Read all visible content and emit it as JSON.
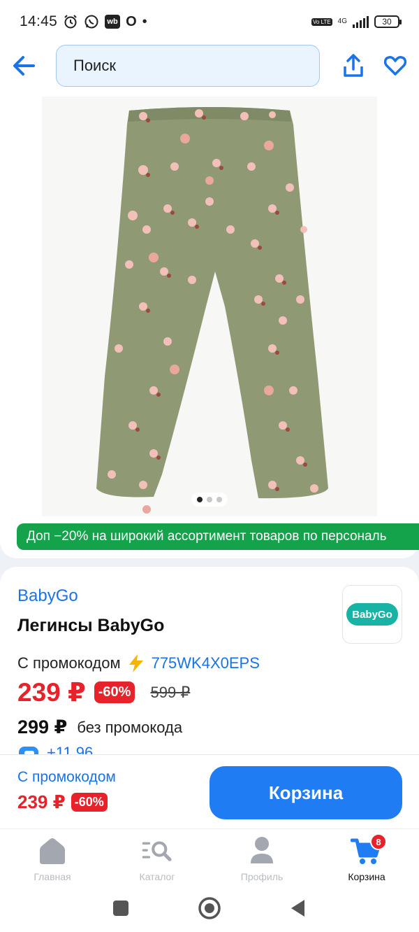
{
  "status_bar": {
    "time": "14:45",
    "icons": [
      "alarm-icon",
      "whatsapp-icon",
      "wb-icon",
      "opera-icon",
      "dot-icon"
    ],
    "wb_label": "wb",
    "opera_label": "O",
    "volte_label": "Vo LTE",
    "network": "4G",
    "battery": "30"
  },
  "header": {
    "search_placeholder": "Поиск",
    "back_icon": "arrow-left-icon",
    "share_icon": "share-icon",
    "favorite_icon": "heart-icon",
    "accent": "#1a73e8"
  },
  "gallery": {
    "image_description_icon": "product-photo-leggings",
    "slide_index": 1,
    "slide_count": 3
  },
  "promo_banner": {
    "text": "Доп −20% на широкий ассортимент товаров по персональ",
    "color": "#14a24a"
  },
  "product": {
    "brand": "BabyGo",
    "brand_logo_text": "BabyGo",
    "title": "Легинсы BabyGo",
    "promo_label": "С промокодом",
    "promo_code": "775WK4X0EPS",
    "price": "239 ₽",
    "discount": "-60%",
    "old_price": "599 ₽",
    "price_without_promo": "299 ₽",
    "without_promo_label": "без промокода",
    "cashback": "+11,96",
    "price_color": "#e8222a"
  },
  "buy_bar": {
    "promo_label": "С промокодом",
    "price": "239 ₽",
    "discount": "-60%",
    "cart_button": "Корзина",
    "button_color": "#1f7cf2"
  },
  "bottom_nav": {
    "items": [
      {
        "label": "Главная",
        "icon": "home-icon"
      },
      {
        "label": "Каталог",
        "icon": "catalog-search-icon"
      },
      {
        "label": "Профиль",
        "icon": "profile-icon"
      },
      {
        "label": "Корзина",
        "icon": "cart-icon",
        "badge": "8"
      }
    ]
  },
  "system_nav": {
    "icons": [
      "recents-icon",
      "home-circle-icon",
      "back-triangle-icon"
    ]
  }
}
